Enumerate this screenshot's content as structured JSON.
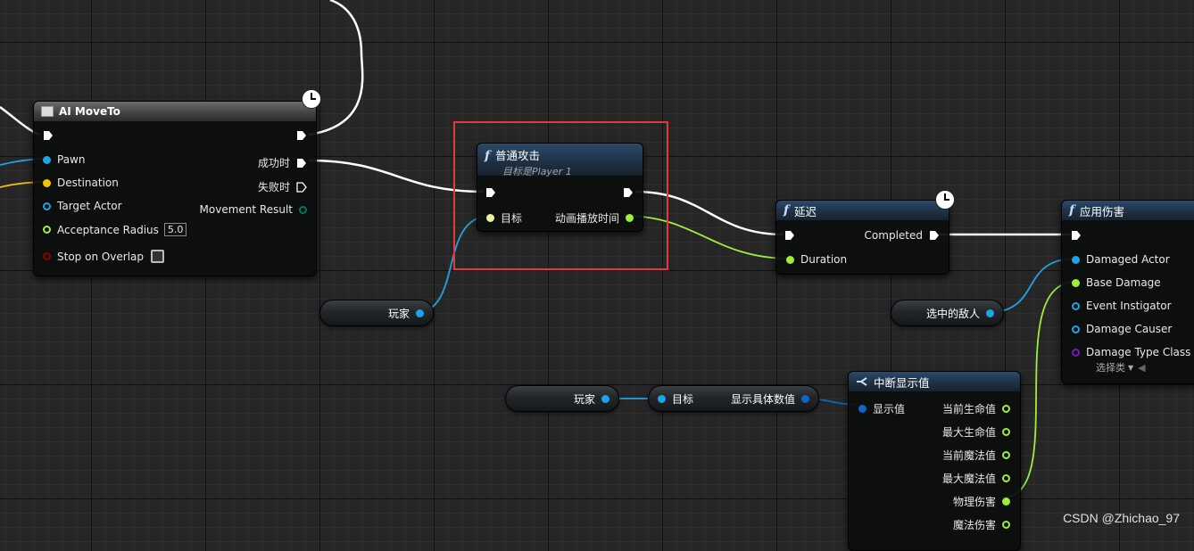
{
  "nodes": {
    "ai_move_to": {
      "title": "AI MoveTo",
      "pins_in": [
        "Pawn",
        "Destination",
        "Target Actor",
        "Acceptance Radius",
        "Stop on Overlap"
      ],
      "acceptance_radius_value": "5.0",
      "pins_out": [
        "成功时",
        "失败时",
        "Movement Result"
      ]
    },
    "normal_attack": {
      "title": "普通攻击",
      "subtitle": "目标是Player 1",
      "pin_in_target": "目标",
      "pin_out_anim": "动画播放时间"
    },
    "delay": {
      "title": "延迟",
      "pin_out_completed": "Completed",
      "pin_in_duration": "Duration"
    },
    "apply_damage": {
      "title": "应用伤害",
      "pins_in": [
        "Damaged Actor",
        "Base Damage",
        "Event Instigator",
        "Damage Causer",
        "Damage Type Class"
      ],
      "select_class": "选择类"
    },
    "break_display": {
      "title": "中断显示值",
      "pin_in": "显示值",
      "pins_out": [
        "当前生命值",
        "最大生命值",
        "当前魔法值",
        "最大魔法值",
        "物理伤害",
        "魔法伤害"
      ]
    },
    "get_display": {
      "pin_in": "目标",
      "pin_out": "显示具体数值"
    }
  },
  "variables": {
    "player_1": "玩家",
    "selected_enemy": "选中的敌人",
    "player_2": "玩家"
  },
  "watermark": "CSDN @Zhichao_97",
  "colors": {
    "object_pin": "#1fa3e8",
    "vector_pin": "#f5c400",
    "float_pin": "#9cf03b",
    "struct_pin": "#1165c2",
    "class_pin": "#6a1fb8",
    "bool_pin": "#8c0000",
    "enum_pin": "#06735e",
    "exec_wire": "#ffffff",
    "highlight": "#e23a3a"
  }
}
